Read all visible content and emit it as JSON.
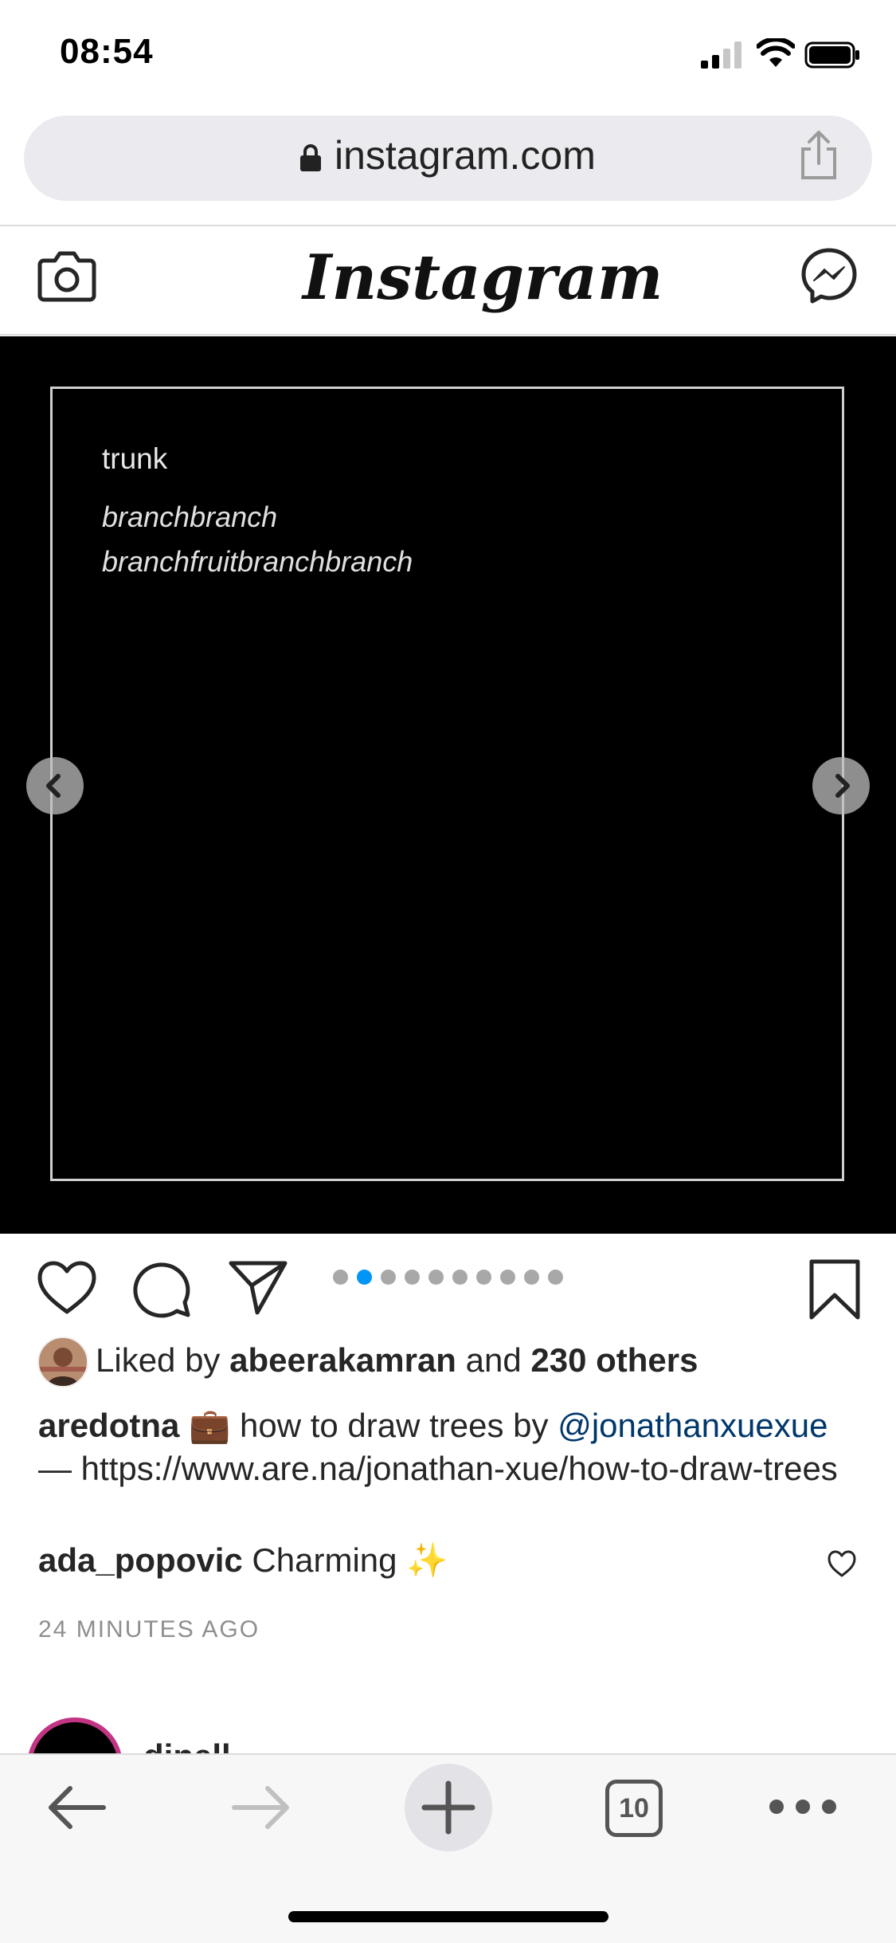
{
  "status_bar": {
    "time": "08:54"
  },
  "browser": {
    "url": "instagram.com",
    "tab_count": "10"
  },
  "header": {
    "logo": "Instagram"
  },
  "media": {
    "title": "trunk",
    "line1": "branchbranch",
    "line2": "branchfruitbranchbranch",
    "carousel_total": 10,
    "carousel_active_index": 1
  },
  "post": {
    "likes_prefix": "Liked by",
    "liker": "abeerakamran",
    "likes_and": "and",
    "likes_others": "230 others",
    "author": "aredotna",
    "author_emoji": "💼",
    "caption_text": "how to draw trees by",
    "mention": "@jonathanxuexue",
    "caption_link": "— https://www.are.na/jonathan-xue/how-to-draw-trees",
    "comment_user": "ada_popovic",
    "comment_text": "Charming ✨",
    "timestamp": "24 MINUTES AGO"
  },
  "next_post": {
    "username": "dinell"
  },
  "colors": {
    "accent_blue": "#0095f6",
    "mention_blue": "#00376b",
    "story_ring": "#c13584"
  }
}
